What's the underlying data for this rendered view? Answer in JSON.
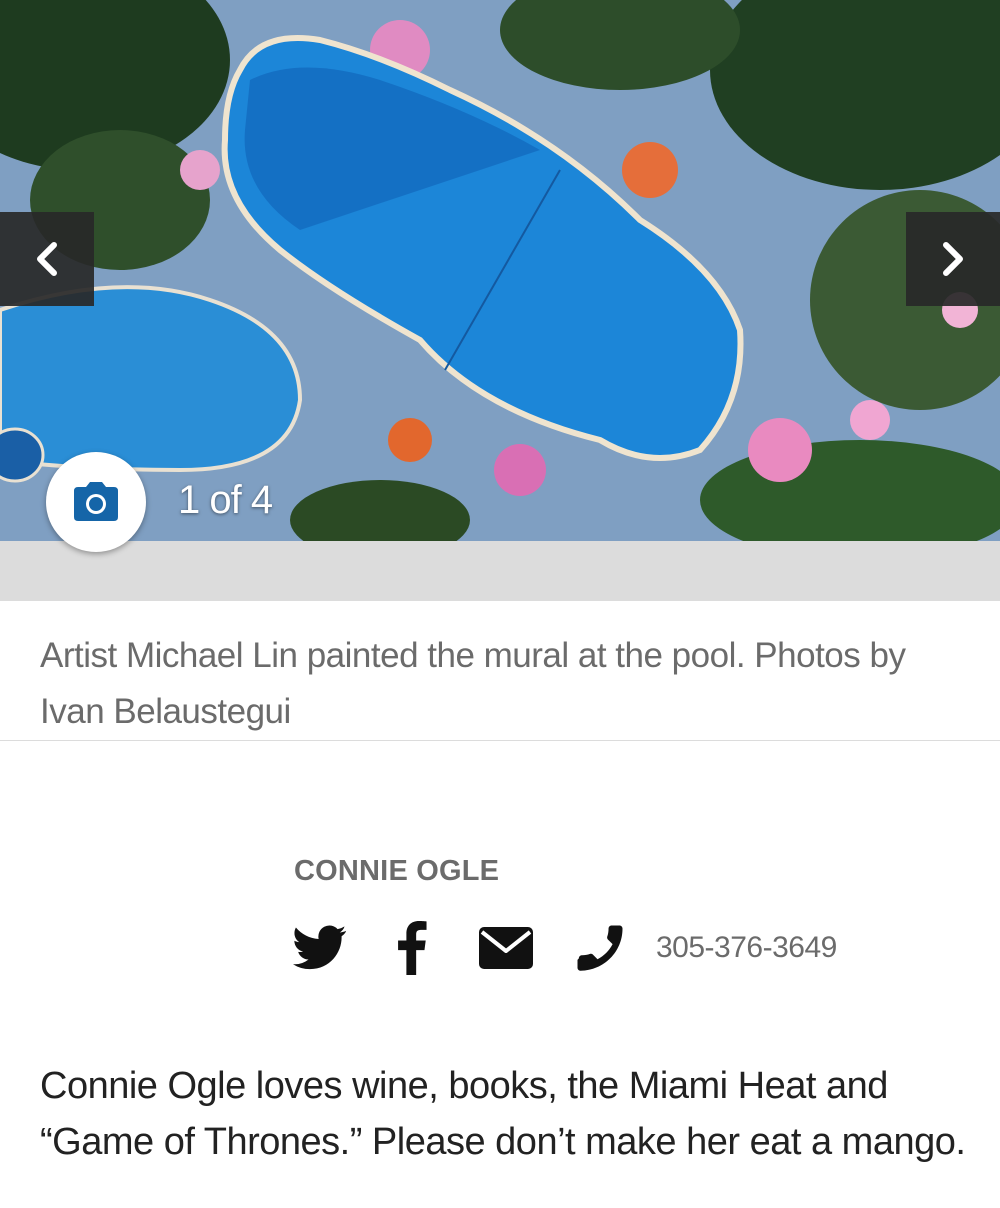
{
  "gallery": {
    "counter_text": "1 of 4",
    "prev_icon": "chevron-left-icon",
    "next_icon": "chevron-right-icon",
    "camera_icon": "camera-icon",
    "colors": {
      "pool": "#1f8fe0",
      "nav_bg": "#2a2a2a",
      "camera": "#1565a8"
    }
  },
  "caption": {
    "text": "Artist Michael Lin painted the mural at the pool. Photos by Ivan Belaustegui"
  },
  "author": {
    "name": "CONNIE OGLE",
    "phone": "305-376-3649",
    "icons": [
      "twitter-icon",
      "facebook-icon",
      "email-icon",
      "phone-icon"
    ],
    "bio": "Connie Ogle loves wine, books, the Miami Heat and “Game of Thrones.” Please don’t make her eat a mango."
  }
}
